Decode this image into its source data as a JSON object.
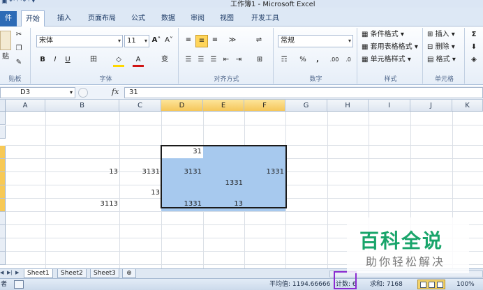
{
  "window": {
    "title": "工作簿1 - Microsoft Excel",
    "quick_access": "▣ ↶ · ↷ · ▾"
  },
  "ribbon": {
    "tabs": [
      {
        "label": "件",
        "type": "file"
      },
      {
        "label": "开始",
        "active": true
      },
      {
        "label": "插入"
      },
      {
        "label": "页面布局"
      },
      {
        "label": "公式"
      },
      {
        "label": "数据"
      },
      {
        "label": "审阅"
      },
      {
        "label": "视图"
      },
      {
        "label": "开发工具"
      }
    ],
    "clipboard": {
      "paste_label": "贴",
      "group_label": "贴板"
    },
    "font": {
      "name": "宋体",
      "size": "11",
      "grow": "A˄",
      "shrink": "A˅",
      "bold": "B",
      "italic": "I",
      "underline": "U",
      "border": "田",
      "fill": "◇",
      "color": "A",
      "phonetic": "变",
      "group_label": "字体"
    },
    "alignment": {
      "group_label": "对齐方式"
    },
    "number": {
      "format": "常规",
      "currency": "☶",
      "percent": "%",
      "comma": ",",
      "inc_decimal": ".00",
      "dec_decimal": ".0",
      "group_label": "数字"
    },
    "styles": {
      "conditional": "条件格式",
      "table": "套用表格格式",
      "cell": "单元格样式",
      "group_label": "样式"
    },
    "cells": {
      "insert": "插入",
      "delete": "删除",
      "format": "格式",
      "group_label": "单元格"
    },
    "editing": {
      "sum": "Σ"
    }
  },
  "formula_bar": {
    "name_box": "D3",
    "fx": "fx",
    "content": "31"
  },
  "grid": {
    "columns": [
      "A",
      "B",
      "C",
      "D",
      "E",
      "F",
      "G",
      "H",
      "I",
      "J",
      "K"
    ],
    "selected_columns": [
      "D",
      "E",
      "F"
    ],
    "cells": [
      {
        "ref": "D3",
        "value": "31"
      },
      {
        "ref": "B5",
        "value": "13"
      },
      {
        "ref": "C5",
        "value": "3131"
      },
      {
        "ref": "D5",
        "value": "3131"
      },
      {
        "ref": "F5",
        "value": "1331"
      },
      {
        "ref": "E6",
        "value": "1331"
      },
      {
        "ref": "C7",
        "value": "13"
      },
      {
        "ref": "B8",
        "value": "3113"
      },
      {
        "ref": "D8",
        "value": "1331"
      },
      {
        "ref": "E8",
        "value": "13"
      }
    ]
  },
  "sheets": {
    "tabs": [
      "Sheet1",
      "Sheet2",
      "Sheet3"
    ],
    "active": "Sheet1"
  },
  "status_bar": {
    "mode": "者",
    "average": "平均值: 1194.66666",
    "count": "计数: 6",
    "sum": "求和: 7168",
    "zoom": "100%"
  },
  "watermark": {
    "main": "百科全说",
    "sub": "助你轻松解决"
  },
  "colors": {
    "selection_fill": "#a7c9ee",
    "selected_header": "#f5c65a",
    "count_highlight": "#8b2bd1",
    "watermark_green": "#19a56b"
  }
}
